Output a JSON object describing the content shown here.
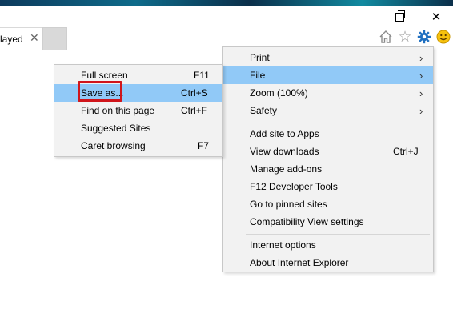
{
  "window": {
    "minimize_glyph": "–",
    "close_glyph": "✕"
  },
  "tab": {
    "label": "layed",
    "close_glyph": "✕"
  },
  "toolbar_icons": [
    "home-icon",
    "star-icon",
    "gear-icon",
    "smiley-icon"
  ],
  "main_menu": {
    "items": [
      {
        "label": "Print",
        "shortcut": "",
        "arrow": "›"
      },
      {
        "label": "File",
        "shortcut": "",
        "arrow": "›"
      },
      {
        "label": "Zoom (100%)",
        "shortcut": "",
        "arrow": "›"
      },
      {
        "label": "Safety",
        "shortcut": "",
        "arrow": "›"
      },
      {
        "label": "Add site to Apps",
        "shortcut": "",
        "arrow": ""
      },
      {
        "label": "View downloads",
        "shortcut": "Ctrl+J",
        "arrow": ""
      },
      {
        "label": "Manage add-ons",
        "shortcut": "",
        "arrow": ""
      },
      {
        "label": "F12 Developer Tools",
        "shortcut": "",
        "arrow": ""
      },
      {
        "label": "Go to pinned sites",
        "shortcut": "",
        "arrow": ""
      },
      {
        "label": "Compatibility View settings",
        "shortcut": "",
        "arrow": ""
      },
      {
        "label": "Internet options",
        "shortcut": "",
        "arrow": ""
      },
      {
        "label": "About Internet Explorer",
        "shortcut": "",
        "arrow": ""
      }
    ],
    "highlighted": "File"
  },
  "file_submenu": {
    "items": [
      {
        "label": "Full screen",
        "shortcut": "F11"
      },
      {
        "label": "Save as...",
        "shortcut": "Ctrl+S"
      },
      {
        "label": "Find on this page",
        "shortcut": "Ctrl+F"
      },
      {
        "label": "Suggested Sites",
        "shortcut": ""
      },
      {
        "label": "Caret browsing",
        "shortcut": "F7"
      }
    ],
    "highlighted": "Save as...",
    "callout_color": "#d0151b"
  },
  "colors": {
    "highlight": "#91c9f7",
    "menu_bg": "#f2f2f2",
    "gear": "#1f6fc0"
  }
}
